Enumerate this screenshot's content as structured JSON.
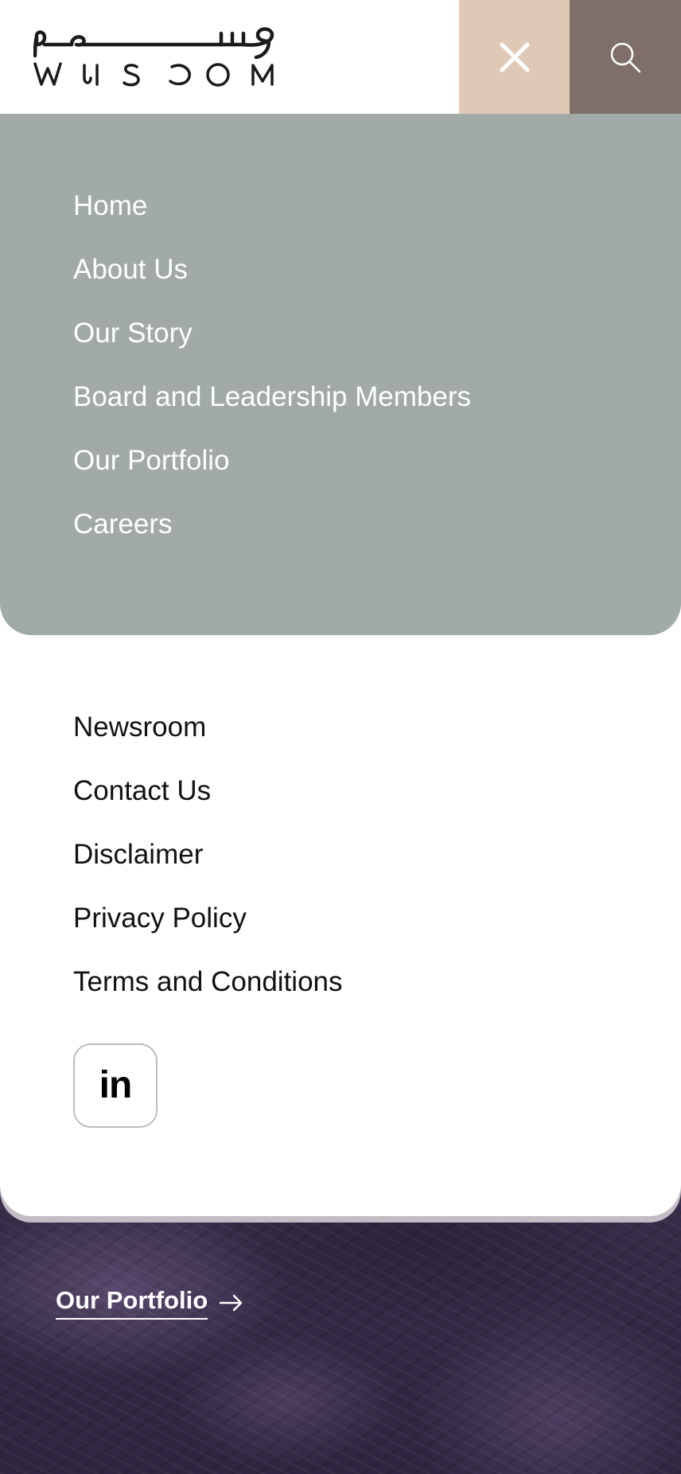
{
  "header": {
    "logo": {
      "arabic_text": "وسوم",
      "latin_text": "WUSOOM"
    },
    "close_icon": "close-icon",
    "search_icon": "search-icon"
  },
  "primary_nav": {
    "items": [
      {
        "label": "Home"
      },
      {
        "label": "About Us"
      },
      {
        "label": "Our Story"
      },
      {
        "label": "Board and Leadership Members"
      },
      {
        "label": "Our Portfolio"
      },
      {
        "label": "Careers"
      }
    ]
  },
  "secondary_nav": {
    "items": [
      {
        "label": "Newsroom"
      },
      {
        "label": "Contact Us"
      },
      {
        "label": "Disclaimer"
      },
      {
        "label": "Privacy Policy"
      },
      {
        "label": "Terms and Conditions"
      }
    ]
  },
  "social": {
    "linkedin_label": "in",
    "icon": "linkedin-icon"
  },
  "hero": {
    "portfolio_link": "Our Portfolio",
    "arrow_icon": "arrow-right-icon"
  },
  "colors": {
    "close_bg": "#dfc9b6",
    "search_bg": "#7e6f6a",
    "primary_nav_bg": "#a1aaa7",
    "hero_bg": "#3a3150"
  }
}
